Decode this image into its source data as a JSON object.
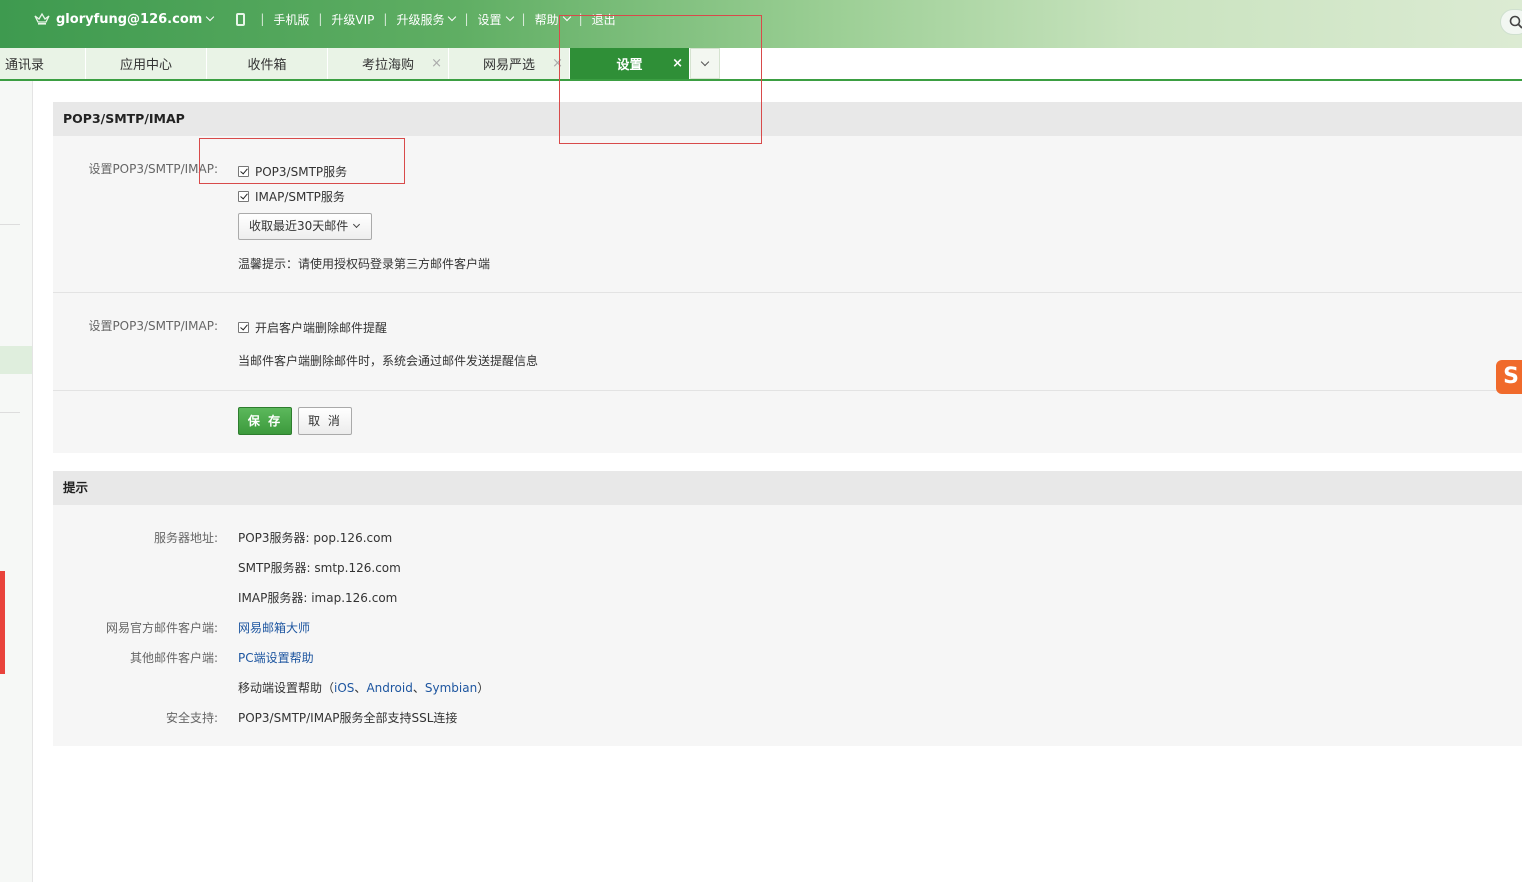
{
  "topbar": {
    "user_email": "gloryfung@126.com",
    "mobile": "手机版",
    "upgrade_vip": "升级VIP",
    "upgrade_service": "升级服务",
    "settings": "设置",
    "help": "帮助",
    "logout": "退出"
  },
  "tabs": [
    {
      "label": "通讯录",
      "closable": false
    },
    {
      "label": "应用中心",
      "closable": false
    },
    {
      "label": "收件箱",
      "closable": false
    },
    {
      "label": "考拉海购",
      "closable": true
    },
    {
      "label": "网易严选",
      "closable": true
    },
    {
      "label": "设置",
      "closable": true,
      "active": true
    }
  ],
  "close_glyph": "×",
  "section1": {
    "title": "POP3/SMTP/IMAP",
    "row1_label": "设置POP3/SMTP/IMAP:",
    "pop3_checkbox": "POP3/SMTP服务",
    "imap_checkbox": "IMAP/SMTP服务",
    "fetch_select": "收取最近30天邮件",
    "tip": "温馨提示：请使用授权码登录第三方邮件客户端",
    "row2_label": "设置POP3/SMTP/IMAP:",
    "delete_reminder_checkbox": "开启客户端删除邮件提醒",
    "delete_reminder_desc": "当邮件客户端删除邮件时，系统会通过邮件发送提醒信息",
    "save": "保 存",
    "cancel": "取 消"
  },
  "section2": {
    "title": "提示",
    "server_label": "服务器地址:",
    "pop3_server": "POP3服务器: pop.126.com",
    "smtp_server": "SMTP服务器: smtp.126.com",
    "imap_server": "IMAP服务器: imap.126.com",
    "official_client_label": "网易官方邮件客户端:",
    "official_client_link": "网易邮箱大师",
    "other_client_label": "其他邮件客户端:",
    "pc_help_link": "PC端设置帮助",
    "mobile_help_prefix": "移动端设置帮助（",
    "ios": "iOS",
    "sep1": "、",
    "android": "Android",
    "sep2": "、",
    "symbian": "Symbian",
    "mobile_help_suffix": "）",
    "security_label": "安全支持:",
    "security_text": "POP3/SMTP/IMAP服务全部支持SSL连接"
  },
  "s_badge": "S"
}
